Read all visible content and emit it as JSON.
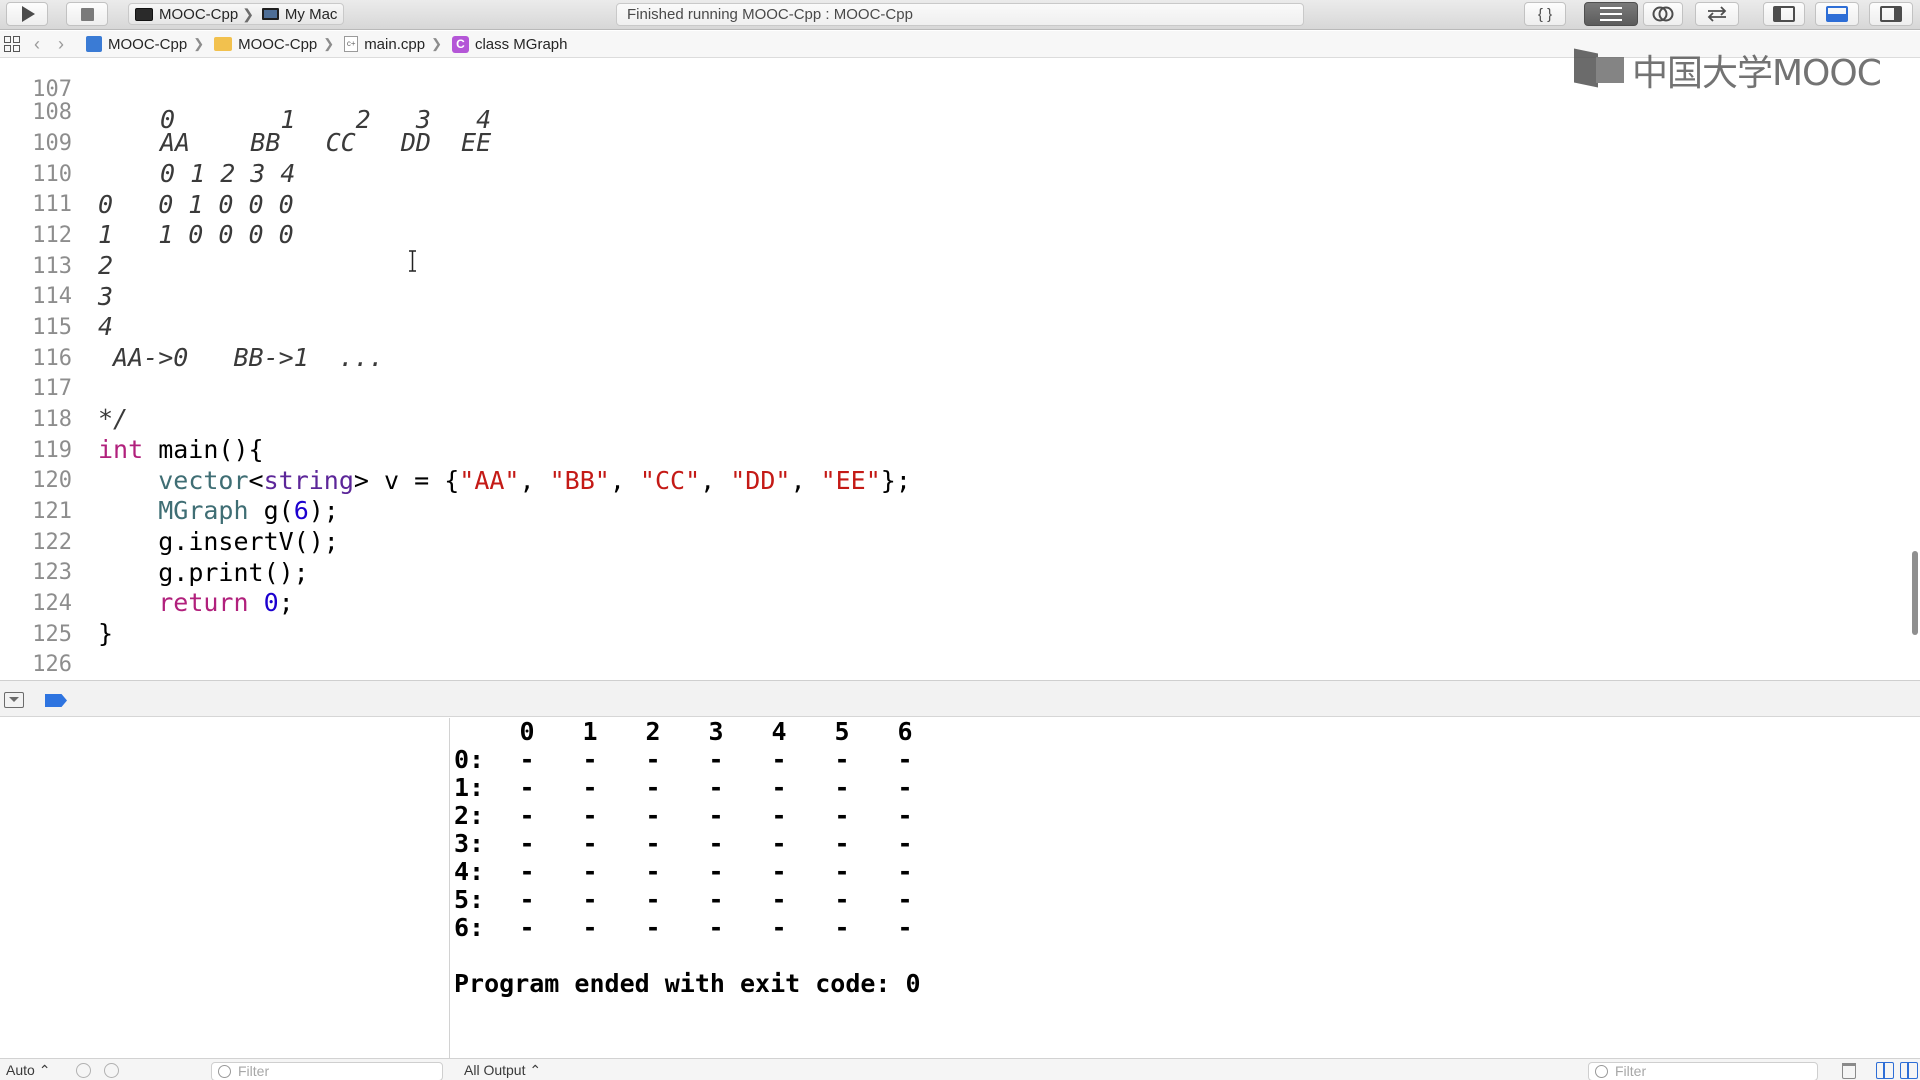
{
  "toolbar": {
    "scheme_target": "MOOC-Cpp",
    "scheme_device": "My Mac",
    "status": "Finished running MOOC-Cpp : MOOC-Cpp",
    "editor_std_glyph": "{ }"
  },
  "jumpbar": {
    "project": "MOOC-Cpp",
    "group": "MOOC-Cpp",
    "file": "main.cpp",
    "class_letter": "C",
    "symbol": "class MGraph"
  },
  "watermark": "中国大学MOOC",
  "editor": {
    "lines": [
      {
        "n": "107",
        "text": "0       1    2   3   4"
      },
      {
        "n": "108",
        "text": "AA    BB   CC   DD  EE"
      },
      {
        "n": "109",
        "text": "0 1 2 3 4"
      },
      {
        "n": "110",
        "text": "0   0 1 0 0 0"
      },
      {
        "n": "111",
        "text": "1   1 0 0 0 0"
      },
      {
        "n": "112",
        "text": "2"
      },
      {
        "n": "113",
        "text": "3"
      },
      {
        "n": "114",
        "text": "4"
      },
      {
        "n": "115",
        "text": " AA->0   BB->1  ..."
      },
      {
        "n": "116",
        "text": ""
      },
      {
        "n": "117",
        "text": "*/"
      },
      {
        "n": "118",
        "kw": "int",
        "rest": " main(){"
      },
      {
        "n": "119",
        "indent": "    ",
        "t1": "vector",
        "p1": "<",
        "t2": "string",
        "p2": "> v = {",
        "s1": "\"AA\"",
        "c1": ", ",
        "s2": "\"BB\"",
        "c2": ", ",
        "s3": "\"CC\"",
        "c3": ", ",
        "s4": "\"DD\"",
        "c4": ", ",
        "s5": "\"EE\"",
        "p3": "};"
      },
      {
        "n": "120",
        "indent": "    ",
        "t1": "MGraph",
        "p1": " g(",
        "num": "6",
        "p2": ");"
      },
      {
        "n": "121",
        "indent": "    ",
        "text": "g.insertV();"
      },
      {
        "n": "122",
        "indent": "    ",
        "text": "g.print();"
      },
      {
        "n": "123",
        "indent": "    ",
        "kw": "return",
        "sp": " ",
        "num": "0",
        "p2": ";"
      },
      {
        "n": "124",
        "text": "}"
      },
      {
        "n": "125",
        "text": ""
      },
      {
        "n": "126",
        "text": ""
      }
    ]
  },
  "console": {
    "header": [
      "0",
      "1",
      "2",
      "3",
      "4",
      "5",
      "6"
    ],
    "rows": [
      {
        "label": "0:",
        "cells": [
          "-",
          "-",
          "-",
          "-",
          "-",
          "-",
          "-"
        ]
      },
      {
        "label": "1:",
        "cells": [
          "-",
          "-",
          "-",
          "-",
          "-",
          "-",
          "-"
        ]
      },
      {
        "label": "2:",
        "cells": [
          "-",
          "-",
          "-",
          "-",
          "-",
          "-",
          "-"
        ]
      },
      {
        "label": "3:",
        "cells": [
          "-",
          "-",
          "-",
          "-",
          "-",
          "-",
          "-"
        ]
      },
      {
        "label": "4:",
        "cells": [
          "-",
          "-",
          "-",
          "-",
          "-",
          "-",
          "-"
        ]
      },
      {
        "label": "5:",
        "cells": [
          "-",
          "-",
          "-",
          "-",
          "-",
          "-",
          "-"
        ]
      },
      {
        "label": "6:",
        "cells": [
          "-",
          "-",
          "-",
          "-",
          "-",
          "-",
          "-"
        ]
      }
    ],
    "exit_message": "Program ended with exit code: 0"
  },
  "bottom_bar": {
    "auto_label": "Auto ⌃",
    "left_filter_placeholder": "Filter",
    "output_select": "All Output ⌃",
    "right_filter_placeholder": "Filter"
  },
  "colors": {
    "keyword": "#b1207c",
    "type": "#3f6e74",
    "string": "#c41a16",
    "number": "#1c00cf",
    "accent": "#2e6ed6"
  }
}
